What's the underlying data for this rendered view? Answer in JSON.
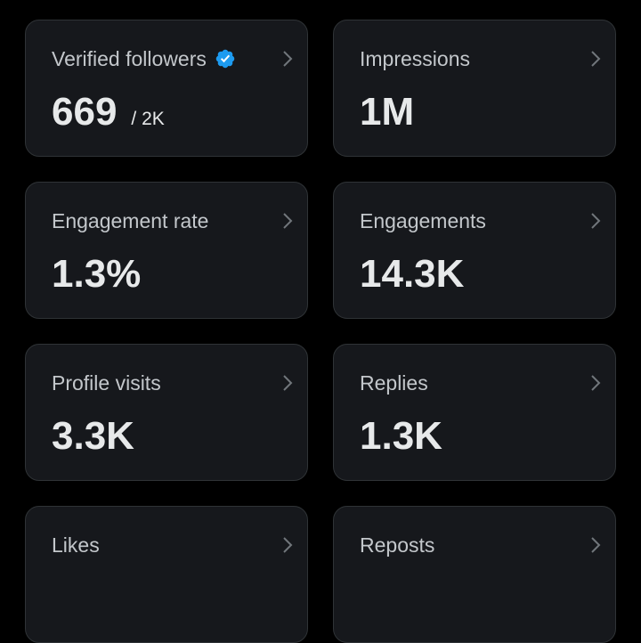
{
  "cards": [
    {
      "label": "Verified followers",
      "value": "669",
      "sub": "/ 2K",
      "verified": true
    },
    {
      "label": "Impressions",
      "value": "1M"
    },
    {
      "label": "Engagement rate",
      "value": "1.3%"
    },
    {
      "label": "Engagements",
      "value": "14.3K"
    },
    {
      "label": "Profile visits",
      "value": "3.3K"
    },
    {
      "label": "Replies",
      "value": "1.3K"
    },
    {
      "label": "Likes",
      "value": ""
    },
    {
      "label": "Reposts",
      "value": ""
    }
  ],
  "icons": {
    "chevron": "chevron-right-icon",
    "verified": "verified-badge-icon"
  },
  "colors": {
    "background": "#000000",
    "card": "#16181c",
    "card_border": "#2f3336",
    "text": "#e7e9ea",
    "label": "#c3c7cb",
    "chevron": "#71767b",
    "verified": "#1d9bf0"
  }
}
